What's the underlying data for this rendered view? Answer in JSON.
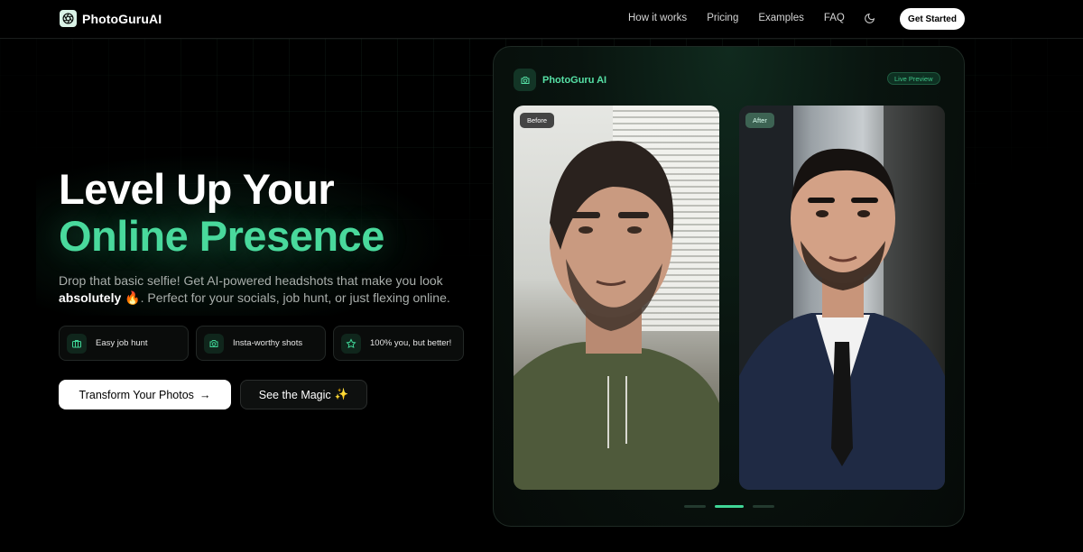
{
  "brand": {
    "name": "PhotoGuruAI"
  },
  "nav": {
    "links": [
      "How it works",
      "Pricing",
      "Examples",
      "FAQ"
    ],
    "cta": "Get Started"
  },
  "hero": {
    "title_line1": "Level Up Your",
    "title_line2": "Online Presence",
    "subtitle_part1": "Drop that basic selfie! Get AI-powered headshots that make you look",
    "subtitle_bold": "absolutely",
    "subtitle_emoji": "🔥",
    "subtitle_part2": ". Perfect for your socials, job hunt, or just flexing online.",
    "features": [
      {
        "icon": "briefcase-icon",
        "label": "Easy job hunt"
      },
      {
        "icon": "camera-icon",
        "label": "Insta-worthy shots"
      },
      {
        "icon": "star-icon",
        "label": "100% you, but better!"
      }
    ],
    "primary_cta": "Transform Your Photos",
    "primary_cta_arrow": "→",
    "secondary_cta": "See the Magic",
    "secondary_cta_emoji": "✨"
  },
  "preview": {
    "title": "PhotoGuru AI",
    "badge": "Live Preview",
    "before_label": "Before",
    "after_label": "After",
    "carousel": {
      "total": 3,
      "active": 2
    }
  },
  "colors": {
    "accent": "#49d99c",
    "background": "#000000",
    "card_bg": "#09140f"
  }
}
